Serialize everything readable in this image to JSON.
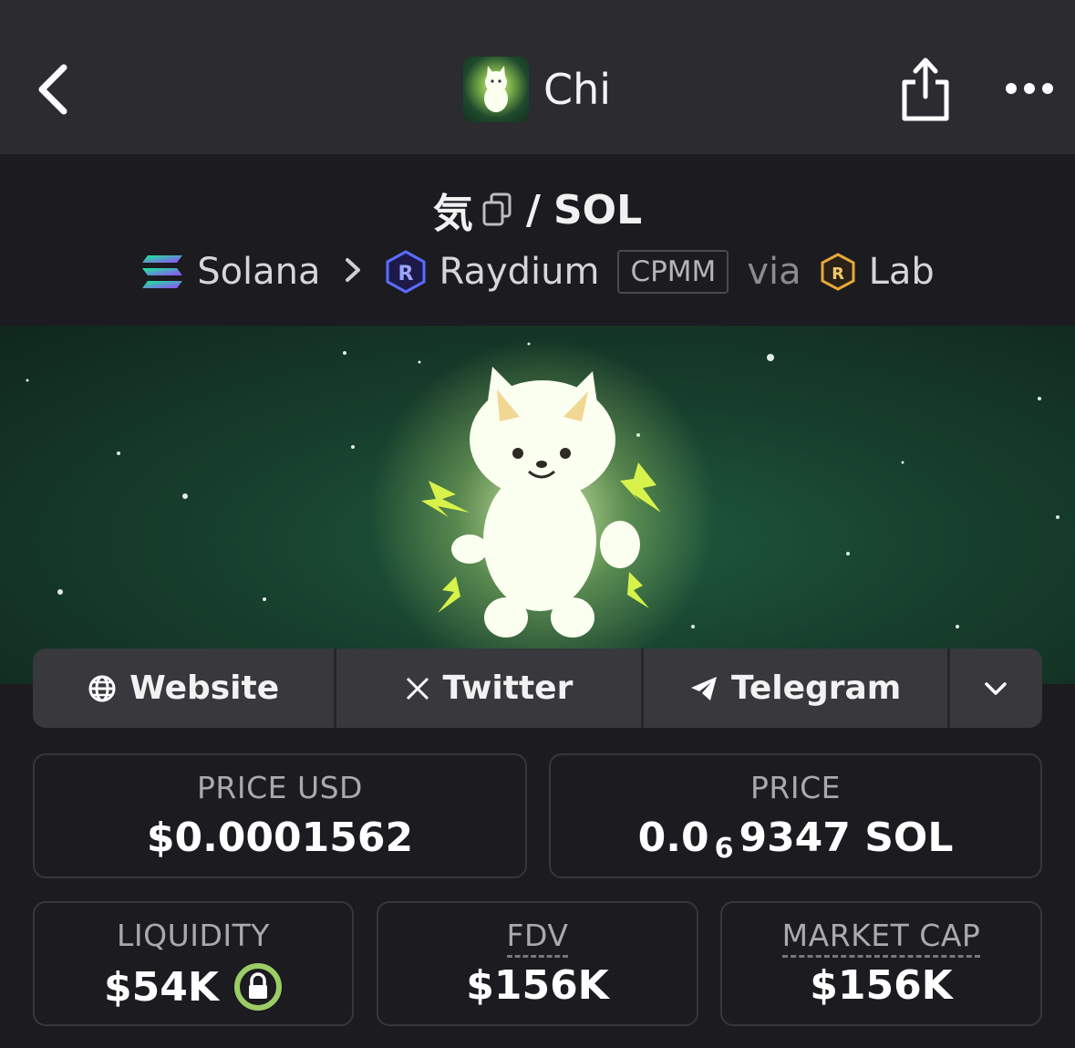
{
  "header": {
    "title": "Chi",
    "colors": {
      "bar": "#2b2b30",
      "background": "#1b1b20"
    }
  },
  "pair": {
    "base": "気",
    "separator": "/",
    "quote": "SOL"
  },
  "route": {
    "chain": "Solana",
    "dex": "Raydium",
    "pool_type": "CPMM",
    "via": "via",
    "launchpad": "Lab"
  },
  "links": [
    {
      "label": "Website",
      "icon": "globe-icon"
    },
    {
      "label": "Twitter",
      "icon": "x-icon"
    },
    {
      "label": "Telegram",
      "icon": "telegram-icon"
    }
  ],
  "stats": {
    "price_usd": {
      "label": "PRICE USD",
      "value": "$0.0001562"
    },
    "price": {
      "label": "PRICE",
      "prefix": "0.0",
      "subscript": "6",
      "suffix": "9347 SOL"
    },
    "liquidity": {
      "label": "LIQUIDITY",
      "value": "$54K",
      "locked_color": "#9ccc65"
    },
    "fdv": {
      "label": "FDV",
      "value": "$156K"
    },
    "market_cap": {
      "label": "MARKET CAP",
      "value": "$156K"
    }
  }
}
